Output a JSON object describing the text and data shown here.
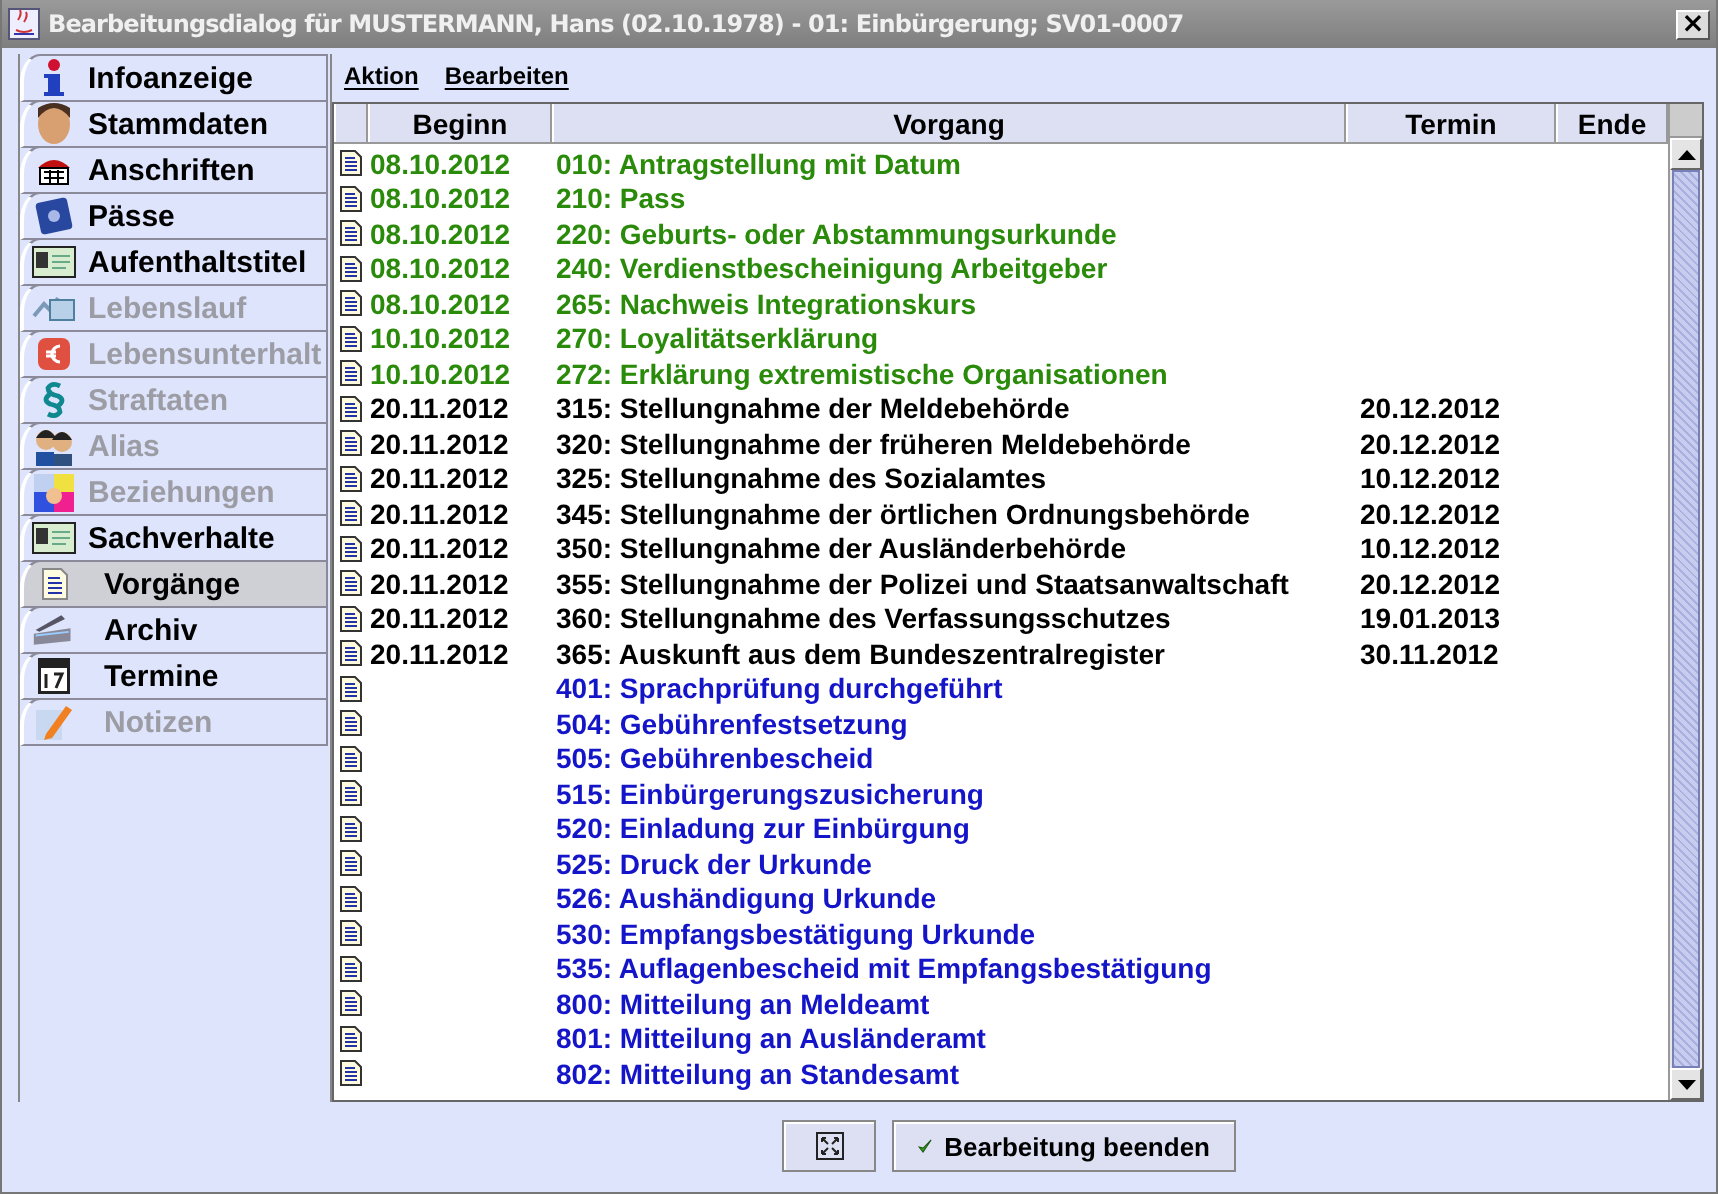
{
  "window": {
    "title": "Bearbeitungsdialog für MUSTERMANN, Hans (02.10.1978) - 01: Einbürgerung; SV01-0007",
    "close": "×"
  },
  "sidebar": {
    "items": [
      {
        "label": "Infoanzeige",
        "disabled": false,
        "selected": false
      },
      {
        "label": "Stammdaten",
        "disabled": false,
        "selected": false
      },
      {
        "label": "Anschriften",
        "disabled": false,
        "selected": false
      },
      {
        "label": "Pässe",
        "disabled": false,
        "selected": false
      },
      {
        "label": "Aufenthaltstitel",
        "disabled": false,
        "selected": false
      },
      {
        "label": "Lebenslauf",
        "disabled": true,
        "selected": false
      },
      {
        "label": "Lebensunterhalt",
        "disabled": true,
        "selected": false
      },
      {
        "label": "Straftaten",
        "disabled": true,
        "selected": false
      },
      {
        "label": "Alias",
        "disabled": true,
        "selected": false
      },
      {
        "label": "Beziehungen",
        "disabled": true,
        "selected": false
      },
      {
        "label": "Sachverhalte",
        "disabled": false,
        "selected": false
      },
      {
        "label": "Vorgänge",
        "disabled": false,
        "selected": true
      },
      {
        "label": "Archiv",
        "disabled": false,
        "selected": false
      },
      {
        "label": "Termine",
        "disabled": false,
        "selected": false
      },
      {
        "label": "Notizen",
        "disabled": true,
        "selected": false
      }
    ]
  },
  "menu": [
    "Aktion",
    "Bearbeiten"
  ],
  "table": {
    "columns": [
      "Beginn",
      "Vorgang",
      "Termin",
      "Ende"
    ],
    "rows": [
      {
        "beginn": "08.10.2012",
        "vorgang": "010: Antragstellung mit Datum",
        "termin": "",
        "color": "#2a8a0a"
      },
      {
        "beginn": "08.10.2012",
        "vorgang": "210: Pass",
        "termin": "",
        "color": "#2a8a0a"
      },
      {
        "beginn": "08.10.2012",
        "vorgang": "220: Geburts- oder Abstammungsurkunde",
        "termin": "",
        "color": "#2a8a0a"
      },
      {
        "beginn": "08.10.2012",
        "vorgang": "240: Verdienstbescheinigung Arbeitgeber",
        "termin": "",
        "color": "#2a8a0a"
      },
      {
        "beginn": "08.10.2012",
        "vorgang": "265: Nachweis Integrationskurs",
        "termin": "",
        "color": "#2a8a0a"
      },
      {
        "beginn": "10.10.2012",
        "vorgang": "270: Loyalitätserklärung",
        "termin": "",
        "color": "#2a8a0a"
      },
      {
        "beginn": "10.10.2012",
        "vorgang": "272: Erklärung extremistische Organisationen",
        "termin": "",
        "color": "#2a8a0a"
      },
      {
        "beginn": "20.11.2012",
        "vorgang": "315: Stellungnahme der Meldebehörde",
        "termin": "20.12.2012",
        "color": "#000000"
      },
      {
        "beginn": "20.11.2012",
        "vorgang": "320: Stellungnahme der früheren Meldebehörde",
        "termin": "20.12.2012",
        "color": "#000000"
      },
      {
        "beginn": "20.11.2012",
        "vorgang": "325: Stellungnahme des Sozialamtes",
        "termin": "10.12.2012",
        "color": "#000000"
      },
      {
        "beginn": "20.11.2012",
        "vorgang": "345: Stellungnahme der örtlichen Ordnungsbehörde",
        "termin": "20.12.2012",
        "color": "#000000"
      },
      {
        "beginn": "20.11.2012",
        "vorgang": "350: Stellungnahme der Ausländerbehörde",
        "termin": "10.12.2012",
        "color": "#000000"
      },
      {
        "beginn": "20.11.2012",
        "vorgang": "355: Stellungnahme der Polizei und Staatsanwaltschaft",
        "termin": "20.12.2012",
        "color": "#000000"
      },
      {
        "beginn": "20.11.2012",
        "vorgang": "360: Stellungnahme des Verfassungsschutzes",
        "termin": "19.01.2013",
        "color": "#000000"
      },
      {
        "beginn": "20.11.2012",
        "vorgang": "365: Auskunft aus dem Bundeszentralregister",
        "termin": "30.11.2012",
        "color": "#000000"
      },
      {
        "beginn": "",
        "vorgang": "401: Sprachprüfung durchgeführt",
        "termin": "",
        "color": "#1414c8"
      },
      {
        "beginn": "",
        "vorgang": "504: Gebührenfestsetzung",
        "termin": "",
        "color": "#1414c8"
      },
      {
        "beginn": "",
        "vorgang": "505: Gebührenbescheid",
        "termin": "",
        "color": "#1414c8"
      },
      {
        "beginn": "",
        "vorgang": "515: Einbürgerungszusicherung",
        "termin": "",
        "color": "#1414c8"
      },
      {
        "beginn": "",
        "vorgang": "520: Einladung zur Einbürgung",
        "termin": "",
        "color": "#1414c8"
      },
      {
        "beginn": "",
        "vorgang": "525: Druck der Urkunde",
        "termin": "",
        "color": "#1414c8"
      },
      {
        "beginn": "",
        "vorgang": "526: Aushändigung Urkunde",
        "termin": "",
        "color": "#1414c8"
      },
      {
        "beginn": "",
        "vorgang": "530: Empfangsbestätigung Urkunde",
        "termin": "",
        "color": "#1414c8"
      },
      {
        "beginn": "",
        "vorgang": "535: Auflagenbescheid mit Empfangsbestätigung",
        "termin": "",
        "color": "#1414c8"
      },
      {
        "beginn": "",
        "vorgang": "800: Mitteilung an Meldeamt",
        "termin": "",
        "color": "#1414c8"
      },
      {
        "beginn": "",
        "vorgang": "801: Mitteilung an Ausländeramt",
        "termin": "",
        "color": "#1414c8"
      },
      {
        "beginn": "",
        "vorgang": "802: Mitteilung an Standesamt",
        "termin": "",
        "color": "#1414c8"
      }
    ]
  },
  "buttons": {
    "finish": "Bearbeitung beenden"
  }
}
